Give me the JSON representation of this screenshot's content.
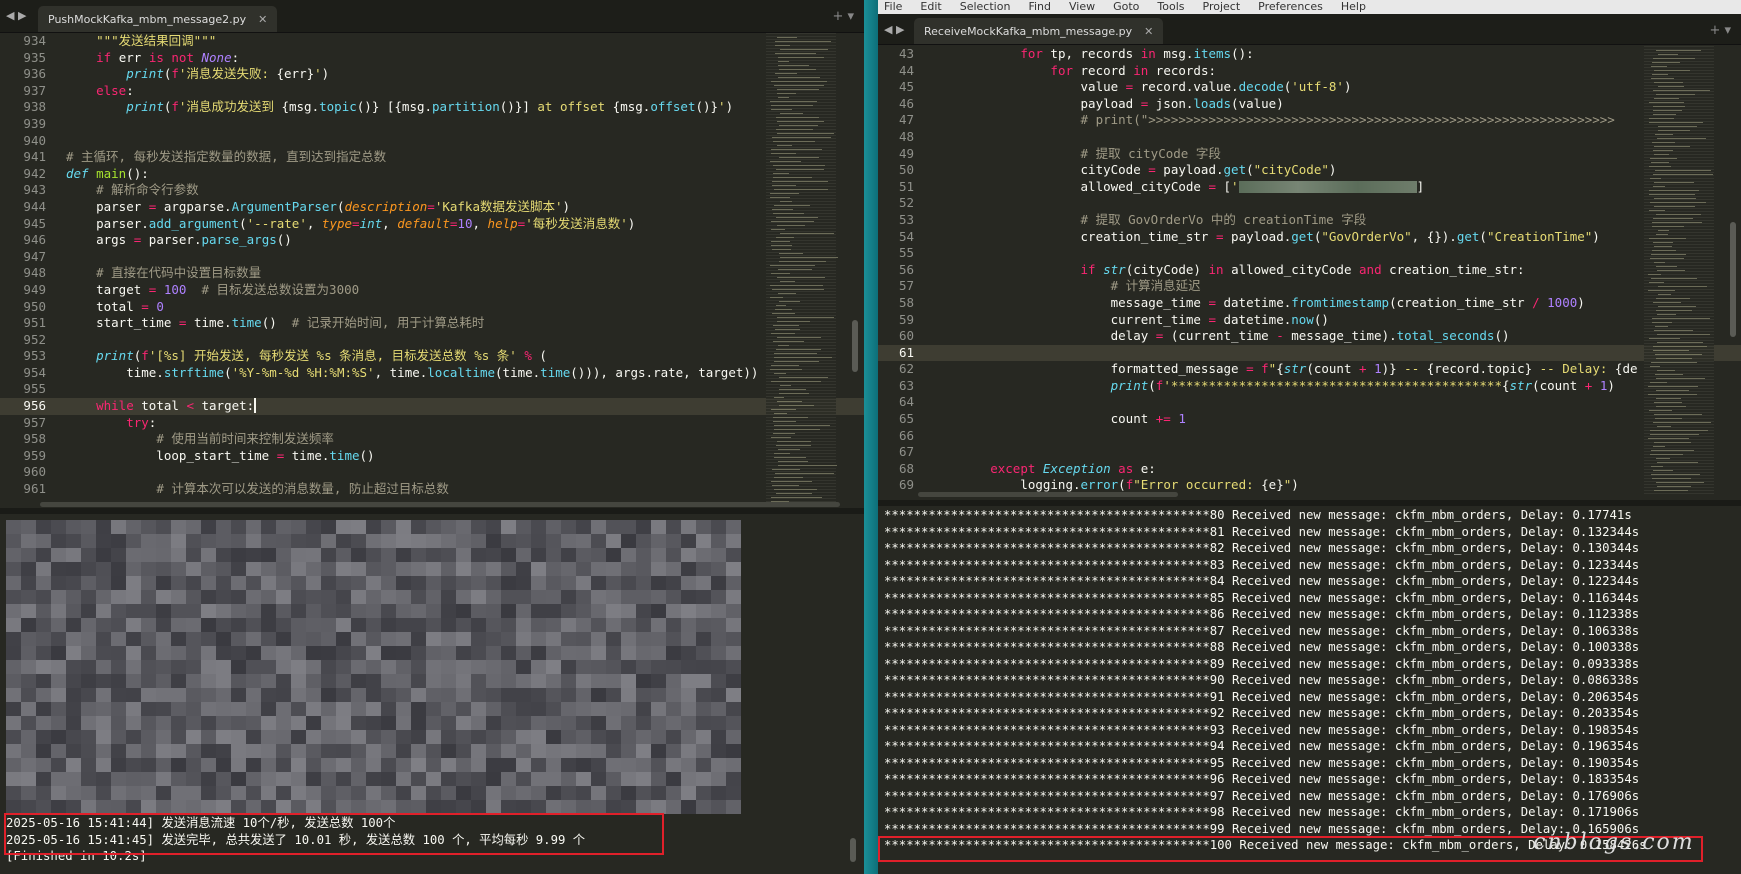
{
  "left": {
    "tab_title": "PushMockKafka_mbm_message2.py",
    "editor_lines": [
      {
        "no": "934",
        "html": "    <span class=\"s\">\"\"\"发送结果回调\"\"\"</span>"
      },
      {
        "no": "935",
        "html": "    <span class=\"k\">if</span> err <span class=\"k\">is not</span> <span class=\"n i\" style=\"color:#ae81ff\">None</span>:"
      },
      {
        "no": "936",
        "html": "        <span class=\"i\">print</span>(<span class=\"k\">f</span><span class=\"s\">'消息发送失败: </span>{err}<span class=\"s\">'</span>)"
      },
      {
        "no": "937",
        "html": "    <span class=\"k\">else</span>:"
      },
      {
        "no": "938",
        "html": "        <span class=\"i\">print</span>(<span class=\"k\">f</span><span class=\"s\">'消息成功发送到 </span>{msg.<span class=\"f\">topic</span>()} [{msg.<span class=\"f\">partition</span>()}] <span class=\"s\">at offset </span>{msg.<span class=\"f\">offset</span>()}<span class=\"s\">'</span>)"
      },
      {
        "no": "939",
        "html": ""
      },
      {
        "no": "940",
        "html": ""
      },
      {
        "no": "941",
        "html": "<span class=\"c\"># 主循环, 每秒发送指定数量的数据, 直到达到指定总数</span>"
      },
      {
        "no": "942",
        "html": "<span class=\"i\" style=\"color:#66d9ef\">def</span> <span style=\"color:#a6e22e\">main</span>():"
      },
      {
        "no": "943",
        "html": "    <span class=\"c\"># 解析命令行参数</span>"
      },
      {
        "no": "944",
        "html": "    parser <span class=\"k\">=</span> argparse.<span class=\"f\">ArgumentParser</span>(<span class=\"p\">description</span><span class=\"k\">=</span><span class=\"s\">'Kafka数据发送脚本'</span>)"
      },
      {
        "no": "945",
        "html": "    parser.<span class=\"f\">add_argument</span>(<span class=\"s\">'--rate'</span>, <span class=\"p\">type</span><span class=\"k\">=</span><span class=\"i\">int</span>, <span class=\"p\">default</span><span class=\"k\">=</span><span class=\"n\">10</span>, <span class=\"p\">help</span><span class=\"k\">=</span><span class=\"s\">'每秒发送消息数'</span>)"
      },
      {
        "no": "946",
        "html": "    args <span class=\"k\">=</span> parser.<span class=\"f\">parse_args</span>()"
      },
      {
        "no": "947",
        "html": ""
      },
      {
        "no": "948",
        "html": "    <span class=\"c\"># 直接在代码中设置目标数量</span>"
      },
      {
        "no": "949",
        "html": "    target <span class=\"k\">=</span> <span class=\"n\">100</span>  <span class=\"c\"># 目标发送总数设置为3000</span>"
      },
      {
        "no": "950",
        "html": "    total <span class=\"k\">=</span> <span class=\"n\">0</span>"
      },
      {
        "no": "951",
        "html": "    start_time <span class=\"k\">=</span> time.<span class=\"f\">time</span>()  <span class=\"c\"># 记录开始时间, 用于计算总耗时</span>"
      },
      {
        "no": "952",
        "html": ""
      },
      {
        "no": "953",
        "html": "    <span class=\"i\">print</span>(<span class=\"k\">f</span><span class=\"s\">'[%s] 开始发送, 每秒发送 %s 条消息, 目标发送总数 %s 条'</span> <span class=\"k\">%</span> ("
      },
      {
        "no": "954",
        "html": "        time.<span class=\"f\">strftime</span>(<span class=\"s\">'%Y-%m-%d %H:%M:%S'</span>, time.<span class=\"f\">localtime</span>(time.<span class=\"f\">time</span>())), args.rate, target))"
      },
      {
        "no": "955",
        "html": ""
      },
      {
        "no": "956",
        "html": "    <span class=\"k\">while</span> total <span class=\"k\">&lt;</span> target:<span style=\"border-left:2px solid #f8f8f0\"></span>",
        "cur": true
      },
      {
        "no": "957",
        "html": "        <span class=\"k\">try</span>:"
      },
      {
        "no": "958",
        "html": "            <span class=\"c\"># 使用当前时间来控制发送频率</span>"
      },
      {
        "no": "959",
        "html": "            loop_start_time <span class=\"k\">=</span> time.<span class=\"f\">time</span>()"
      },
      {
        "no": "960",
        "html": ""
      },
      {
        "no": "961",
        "html": "            <span class=\"c\"># 计算本次可以发送的消息数量, 防止超过目标总数</span>"
      }
    ],
    "console_lines": [
      "2025-05-16 15:41:44] 发送消息流速 10个/秒, 发送总数 100个",
      "2025-05-16 15:41:45] 发送完毕, 总共发送了 10.01 秒, 发送总数 100 个, 平均每秒 9.99 个",
      "[Finished in 10.2s]"
    ]
  },
  "right": {
    "menu": [
      "File",
      "Edit",
      "Selection",
      "Find",
      "View",
      "Goto",
      "Tools",
      "Project",
      "Preferences",
      "Help"
    ],
    "tab_title": "ReceiveMockKafka_mbm_message.py",
    "editor_lines": [
      {
        "no": "43",
        "html": "            <span class=\"k\">for</span> tp, records <span class=\"k\">in</span> msg.<span class=\"f\">items</span>():"
      },
      {
        "no": "44",
        "html": "                <span class=\"k\">for</span> record <span class=\"k\">in</span> records:"
      },
      {
        "no": "45",
        "html": "                    value <span class=\"k\">=</span> record.value.<span class=\"f\">decode</span>(<span class=\"s\">'utf-8'</span>)"
      },
      {
        "no": "46",
        "html": "                    payload <span class=\"k\">=</span> json.<span class=\"f\">loads</span>(value)"
      },
      {
        "no": "47",
        "html": "                    <span class=\"c\"># print(\"&gt;&gt;&gt;&gt;&gt;&gt;&gt;&gt;&gt;&gt;&gt;&gt;&gt;&gt;&gt;&gt;&gt;&gt;&gt;&gt;&gt;&gt;&gt;&gt;&gt;&gt;&gt;&gt;&gt;&gt;&gt;&gt;&gt;&gt;&gt;&gt;&gt;&gt;&gt;&gt;&gt;&gt;&gt;&gt;&gt;&gt;&gt;&gt;&gt;&gt;&gt;&gt;&gt;&gt;&gt;&gt;&gt;&gt;&gt;&gt;&gt;&gt;</span>"
      },
      {
        "no": "48",
        "html": ""
      },
      {
        "no": "49",
        "html": "                    <span class=\"c\"># 提取 cityCode 字段</span>"
      },
      {
        "no": "50",
        "html": "                    cityCode <span class=\"k\">=</span> payload.<span class=\"f\">get</span>(<span class=\"s\">\"cityCode\"</span>)"
      },
      {
        "no": "51",
        "html": "                    allowed_cityCode <span class=\"k\">=</span> [<span class=\"s\">'</span><span style=\"display:inline-block;width:178px;height:12px;background:linear-gradient(90deg,#5b6d5a,#778574,#5b6d5a,#6f7d6b);vertical-align:middle\"></span>]"
      },
      {
        "no": "52",
        "html": ""
      },
      {
        "no": "53",
        "html": "                    <span class=\"c\"># 提取 GovOrderVo 中的 creationTime 字段</span>"
      },
      {
        "no": "54",
        "html": "                    creation_time_str <span class=\"k\">=</span> payload.<span class=\"f\">get</span>(<span class=\"s\">\"GovOrderVo\"</span>, {}).<span class=\"f\">get</span>(<span class=\"s\">\"CreationTime\"</span>)"
      },
      {
        "no": "55",
        "html": ""
      },
      {
        "no": "56",
        "html": "                    <span class=\"k\">if</span> <span class=\"i\">str</span>(cityCode) <span class=\"k\">in</span> allowed_cityCode <span class=\"k\">and</span> creation_time_str:"
      },
      {
        "no": "57",
        "html": "                        <span class=\"c\"># 计算消息延迟</span>"
      },
      {
        "no": "58",
        "html": "                        message_time <span class=\"k\">=</span> datetime.<span class=\"f\">fromtimestamp</span>(creation_time_str <span class=\"k\">/</span> <span class=\"n\">1000</span>)"
      },
      {
        "no": "59",
        "html": "                        current_time <span class=\"k\">=</span> datetime.<span class=\"f\">now</span>()"
      },
      {
        "no": "60",
        "html": "                        delay <span class=\"k\">=</span> (current_time <span class=\"k\">-</span> message_time).<span class=\"f\">total_seconds</span>()"
      },
      {
        "no": "61",
        "html": "",
        "cur": true
      },
      {
        "no": "62",
        "html": "                        formatted_message <span class=\"k\">=</span> <span class=\"k\">f</span><span class=\"s\">\"</span>{<span class=\"i\">str</span>(count <span class=\"k\">+</span> <span class=\"n\">1</span>)}<span class=\"s\"> -- </span>{record.topic}<span class=\"s\"> -- Delay: </span>{de"
      },
      {
        "no": "63",
        "html": "                        <span class=\"i\">print</span>(<span class=\"k\">f</span><span class=\"s\">'********************************************</span>{<span class=\"i\">str</span>(count <span class=\"k\">+</span> <span class=\"n\">1</span>)"
      },
      {
        "no": "64",
        "html": ""
      },
      {
        "no": "65",
        "html": "                        count <span class=\"k\">+=</span> <span class=\"n\">1</span>"
      },
      {
        "no": "66",
        "html": ""
      },
      {
        "no": "67",
        "html": ""
      },
      {
        "no": "68",
        "html": "        <span class=\"k\">except</span> <span class=\"i\">Exception</span> <span class=\"k\">as</span> e:"
      },
      {
        "no": "69",
        "html": "            logging.<span class=\"f\">error</span>(<span class=\"k\">f</span><span class=\"s\">\"Error occurred: </span>{e}<span class=\"s\">\"</span>)"
      }
    ],
    "console_lines": [
      "********************************************80 Received new message: ckfm_mbm_orders, Delay: 0.17741s",
      "********************************************81 Received new message: ckfm_mbm_orders, Delay: 0.132344s",
      "********************************************82 Received new message: ckfm_mbm_orders, Delay: 0.130344s",
      "********************************************83 Received new message: ckfm_mbm_orders, Delay: 0.123344s",
      "********************************************84 Received new message: ckfm_mbm_orders, Delay: 0.122344s",
      "********************************************85 Received new message: ckfm_mbm_orders, Delay: 0.116344s",
      "********************************************86 Received new message: ckfm_mbm_orders, Delay: 0.112338s",
      "********************************************87 Received new message: ckfm_mbm_orders, Delay: 0.106338s",
      "********************************************88 Received new message: ckfm_mbm_orders, Delay: 0.100338s",
      "********************************************89 Received new message: ckfm_mbm_orders, Delay: 0.093338s",
      "********************************************90 Received new message: ckfm_mbm_orders, Delay: 0.086338s",
      "********************************************91 Received new message: ckfm_mbm_orders, Delay: 0.206354s",
      "********************************************92 Received new message: ckfm_mbm_orders, Delay: 0.203354s",
      "********************************************93 Received new message: ckfm_mbm_orders, Delay: 0.198354s",
      "********************************************94 Received new message: ckfm_mbm_orders, Delay: 0.196354s",
      "********************************************95 Received new message: ckfm_mbm_orders, Delay: 0.190354s",
      "********************************************96 Received new message: ckfm_mbm_orders, Delay: 0.183354s",
      "********************************************97 Received new message: ckfm_mbm_orders, Delay: 0.176906s",
      "********************************************98 Received new message: ckfm_mbm_orders, Delay: 0.171906s",
      "********************************************99 Received new message: ckfm_mbm_orders, Delay: 0.165906s",
      "********************************************100 Received new message: ckfm_mbm_orders, Delay: 0.158426s"
    ],
    "watermark": "cnblogs.com"
  },
  "colors": {
    "highlight_box": "#e0202a",
    "editor_bg": "#272822"
  }
}
